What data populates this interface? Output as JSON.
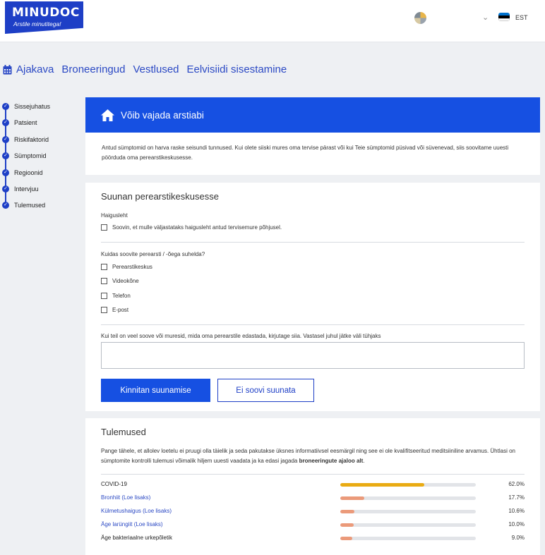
{
  "brand": {
    "name": "MINUDOC",
    "tagline": "Arstile minutitega!"
  },
  "header": {
    "language": "EST",
    "colors": {
      "brand": "#1e3fc6",
      "accent": "#1650e2"
    }
  },
  "nav": {
    "items": [
      "Ajakava",
      "Broneeringud",
      "Vestlused",
      "Eelvisiidi sisestamine"
    ]
  },
  "steps": [
    "Sissejuhatus",
    "Patsient",
    "Riskifaktorid",
    "Sümptomid",
    "Regioonid",
    "Intervjuu",
    "Tulemused"
  ],
  "alert": {
    "title": "Võib vajada arstiabi",
    "body": "Antud sümptomid on harva raske seisundi tunnused. Kui olete siiski mures oma tervise pärast või kui Teie sümptomid püsivad või süvenevad, siis soovitame uuesti pöörduda oma perearstikeskusesse."
  },
  "referral": {
    "title": "Suunan perearstikeskusesse",
    "sick_leave_label": "Haigusleht",
    "sick_leave_option": "Soovin, et mulle väljastataks haigusleht antud tervisemure põhjusel.",
    "contact_question": "Kuidas soovite perearsti / -õega suhelda?",
    "contact_options": [
      "Perearstikeskus",
      "Videokõne",
      "Telefon",
      "E-post"
    ],
    "comment_label": "Kui teil on veel soove või muresid, mida oma perearstile edastada, kirjutage siia. Vastasel juhul jätke väli tühjaks",
    "comment_value": "",
    "confirm_button": "Kinnitan suunamise",
    "decline_button": "Ei soovi suunata"
  },
  "results": {
    "title": "Tulemused",
    "note": "Pange tähele, et allolev loetelu ei pruugi olla täielik ja seda pakutakse üksnes informatiivsel eesmärgil ning see ei ole kvalifitseeritud meditsiiniline arvamus. Ühtlasi on sümptomite kontrolli tulemusi võimalik hiljem uuesti vaadata ja ka edasi jagada",
    "note_link": "broneeringute ajaloo alt",
    "items": [
      {
        "name": "COVID-19",
        "value": "62.0%",
        "percent": 62.0,
        "color": "#e9ab13",
        "link": false
      },
      {
        "name": "Bronhiit (Loe lisaks)",
        "value": "17.7%",
        "percent": 17.7,
        "color": "#eb9a7a",
        "link": true
      },
      {
        "name": "Külmetushaigus (Loe lisaks)",
        "value": "10.6%",
        "percent": 10.6,
        "color": "#eb9a7a",
        "link": true
      },
      {
        "name": "Äge larüngiit (Loe lisaks)",
        "value": "10.0%",
        "percent": 10.0,
        "color": "#eb9a7a",
        "link": true
      },
      {
        "name": "Äge bakteriaalne urkepõletik",
        "value": "9.0%",
        "percent": 9.0,
        "color": "#eb9a7a",
        "link": false
      }
    ]
  }
}
